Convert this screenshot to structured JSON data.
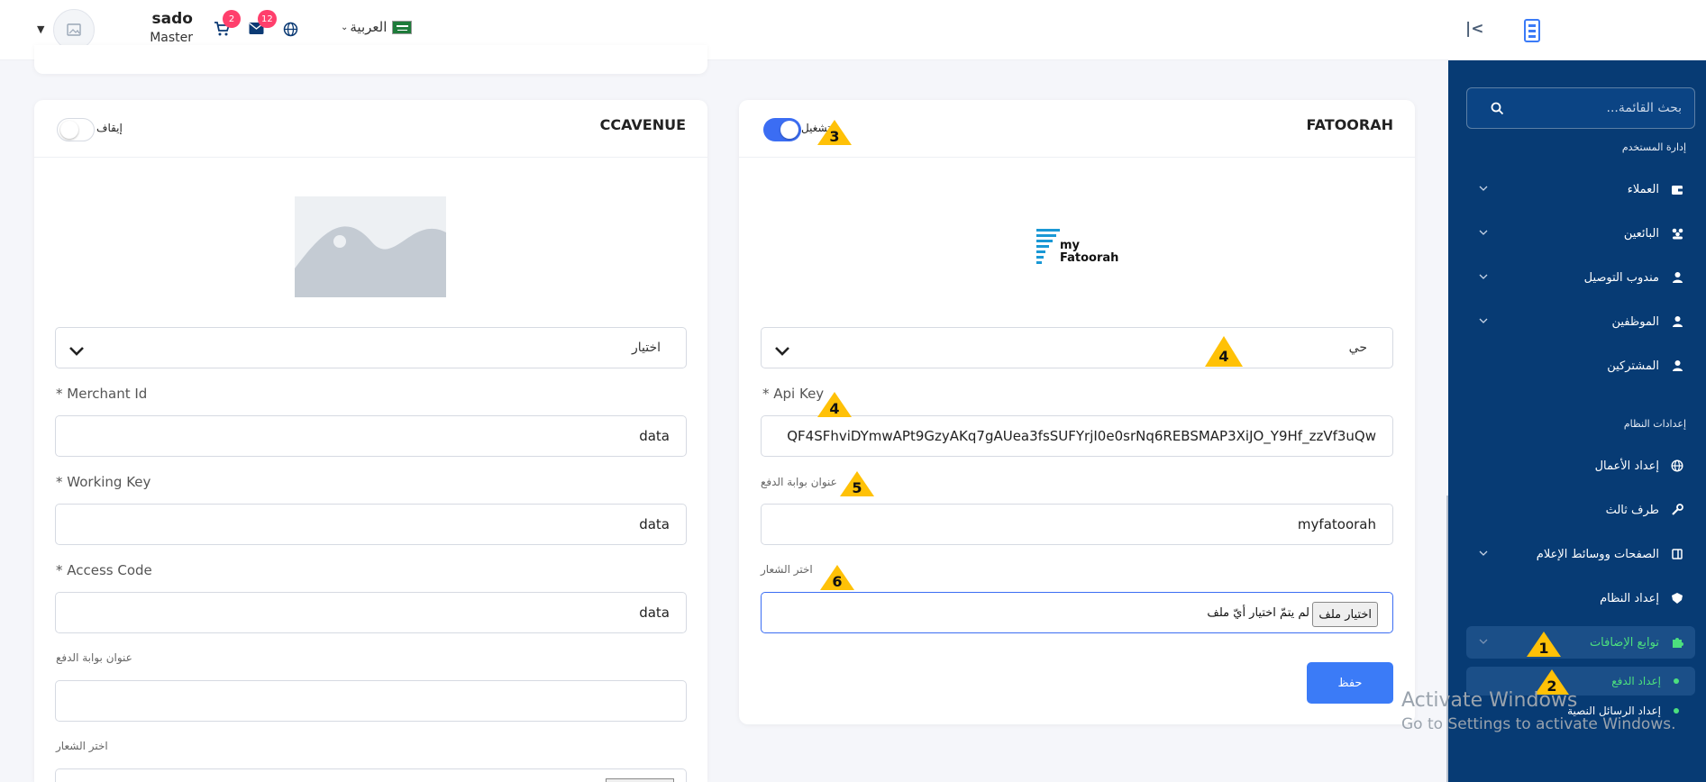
{
  "header": {
    "user_name": "sado",
    "user_role": "Master Admin",
    "cart_badge": "2",
    "messages_badge": "12",
    "language": "العربية",
    "collapse_label": "|<"
  },
  "sidebar": {
    "search_placeholder": "بحث القائمة...",
    "section_user": "إدارة المستخدم",
    "section_system": "إعدادات النظام",
    "items": [
      {
        "label": "العملاء",
        "icon": "wallet-icon"
      },
      {
        "label": "البائعين",
        "icon": "sellers-icon"
      },
      {
        "label": "مندوب التوصيل",
        "icon": "person-icon"
      },
      {
        "label": "الموظفين",
        "icon": "person-icon"
      },
      {
        "label": "المشتركين",
        "icon": "person-icon"
      },
      {
        "label": "إعداد الأعمال",
        "icon": "globe-icon"
      },
      {
        "label": "طرف ثالث",
        "icon": "tools-icon"
      },
      {
        "label": "الصفحات ووسائط الإعلام",
        "icon": "pages-icon"
      },
      {
        "label": "إعداد النظام",
        "icon": "shield-icon"
      },
      {
        "label": "توابع الإضافات",
        "icon": "puzzle-icon"
      }
    ],
    "sub_items": [
      {
        "label": "إعداد الدفع"
      },
      {
        "label": "إعداد الرسائل النصية"
      }
    ]
  },
  "fatoorah": {
    "title": "FATOORAH",
    "toggle_label": "تشغيل",
    "toggle_on": true,
    "logo_text_1": "my",
    "logo_text_2": "Fatoorah",
    "mode_value": "حي",
    "api_key_label": "* Api Key",
    "api_key_value": "QF4SFhviDYmwAPt9GzyAKq7gAUea3fsSUFYrjI0e0srNq6REBSMAP3XiJO_Y9Hf_zzVf3uQw",
    "gateway_title_label": "عنوان بوابة الدفع",
    "gateway_title_value": "myfatoorah",
    "logo_label": "اختر الشعار",
    "file_button": "اختيار ملف",
    "file_none": "لم يتمّ اختيار أيّ ملف",
    "save_label": "حفظ"
  },
  "ccavenue": {
    "title": "CCAVENUE",
    "toggle_label": "إيقاف",
    "toggle_on": false,
    "mode_value": "اختيار",
    "merchant_label": "* Merchant Id",
    "merchant_value": "data",
    "working_key_label": "* Working Key",
    "working_key_value": "data",
    "access_code_label": "* Access Code",
    "access_code_value": "data",
    "gateway_title_label": "عنوان بوابة الدفع",
    "gateway_title_value": "",
    "logo_label": "اختر الشعار"
  },
  "markers": [
    "1",
    "2",
    "3",
    "4",
    "4",
    "5",
    "6"
  ],
  "watermark": {
    "line1": "Activate Windows",
    "line2": "Go to Settings to activate Windows."
  },
  "colors": {
    "sidebar_bg": "#073b74",
    "accent": "#3b6df3",
    "active_green": "#4ce07e",
    "badge_red": "#ff3f6c",
    "marker_yellow": "#ffc107"
  }
}
